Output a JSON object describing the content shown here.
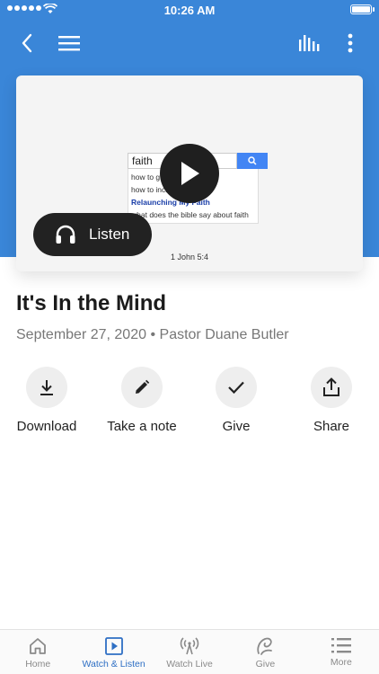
{
  "status_bar": {
    "time": "10:26 AM"
  },
  "video": {
    "search_query": "faith",
    "suggestions": [
      {
        "text": "how to get more faith",
        "highlight": false
      },
      {
        "text": "how to increase faith",
        "highlight": false
      },
      {
        "text": "Relaunching My Faith",
        "highlight": true
      },
      {
        "text": "what does the bible say about faith",
        "highlight": false
      }
    ],
    "verse": "1 John 5:4"
  },
  "listen_label": "Listen",
  "sermon": {
    "title": "It's In the Mind",
    "date": "September 27, 2020",
    "separator": "•",
    "speaker": "Pastor Duane Butler"
  },
  "actions": [
    {
      "label": "Download",
      "icon": "download-icon"
    },
    {
      "label": "Take a note",
      "icon": "pencil-icon"
    },
    {
      "label": "Give",
      "icon": "checkmark-icon"
    },
    {
      "label": "Share",
      "icon": "share-icon"
    }
  ],
  "tabs": [
    {
      "label": "Home",
      "icon": "home-icon",
      "active": false
    },
    {
      "label": "Watch & Listen",
      "icon": "play-square-icon",
      "active": true
    },
    {
      "label": "Watch Live",
      "icon": "broadcast-icon",
      "active": false
    },
    {
      "label": "Give",
      "icon": "give-icon",
      "active": false
    },
    {
      "label": "More",
      "icon": "list-icon",
      "active": false
    }
  ],
  "colors": {
    "header": "#3a86d8",
    "accent": "#2e6fc4",
    "tab_inactive": "#8a8a8a"
  }
}
